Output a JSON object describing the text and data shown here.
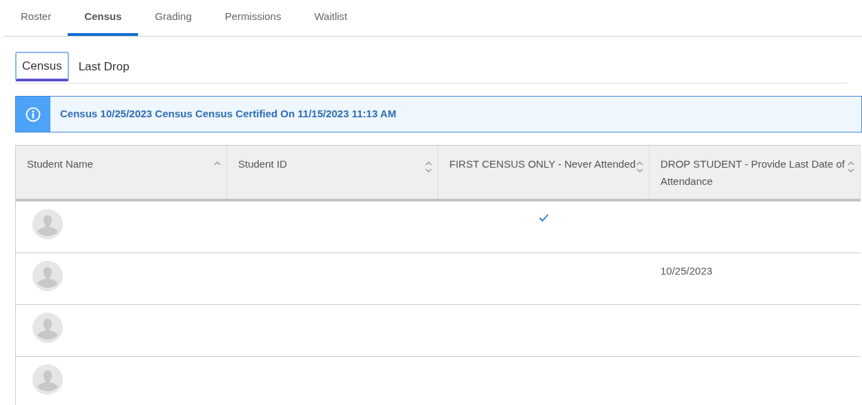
{
  "tabs": [
    {
      "label": "Roster",
      "selected": false
    },
    {
      "label": "Census",
      "selected": true
    },
    {
      "label": "Grading",
      "selected": false
    },
    {
      "label": "Permissions",
      "selected": false
    },
    {
      "label": "Waitlist",
      "selected": false
    }
  ],
  "subtabs": [
    {
      "label": "Census",
      "selected": true
    },
    {
      "label": "Last Drop",
      "selected": false
    }
  ],
  "info_banner": {
    "text": "Census 10/25/2023 Census Census Certified On 11/15/2023 11:13 AM"
  },
  "table": {
    "columns": [
      {
        "label": "Student Name",
        "sorted": true
      },
      {
        "label": "Student ID",
        "sorted": false
      },
      {
        "label": "FIRST CENSUS ONLY - Never Attended",
        "sorted": false
      },
      {
        "label": "DROP STUDENT - Provide Last Date of Attendance",
        "sorted": false
      }
    ],
    "rows": [
      {
        "never_attended": true
      },
      {
        "never_attended": false,
        "last_date": "10/25/2023"
      },
      {
        "never_attended": false
      },
      {
        "never_attended": false
      }
    ]
  }
}
